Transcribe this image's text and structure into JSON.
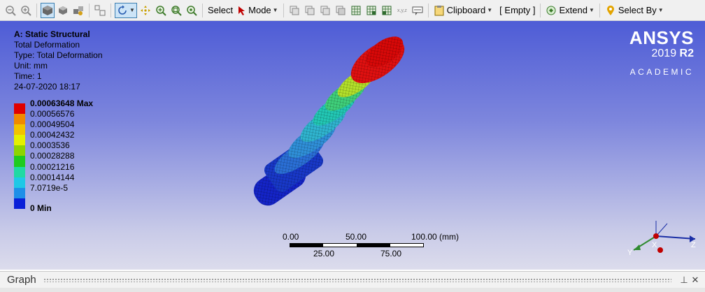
{
  "toolbar": {
    "select_label": "Select",
    "mode_label": "Mode",
    "clipboard_label": "Clipboard",
    "empty_label": "[ Empty ]",
    "extend_label": "Extend",
    "select_by_label": "Select By"
  },
  "result": {
    "title": "A: Static Structural",
    "name": "Total Deformation",
    "type": "Type: Total Deformation",
    "unit": "Unit: mm",
    "time": "Time: 1",
    "date": "24-07-2020 18:17"
  },
  "legend": {
    "items": [
      {
        "label": "0.00063648 Max",
        "color": "#e00000"
      },
      {
        "label": "0.00056576",
        "color": "#f08a00"
      },
      {
        "label": "0.00049504",
        "color": "#f2c300"
      },
      {
        "label": "0.00042432",
        "color": "#e4f000"
      },
      {
        "label": "0.0003536",
        "color": "#8ed400"
      },
      {
        "label": "0.00028288",
        "color": "#1fcb1f"
      },
      {
        "label": "0.00021216",
        "color": "#20d9a3"
      },
      {
        "label": "0.00014144",
        "color": "#1fc8e6"
      },
      {
        "label": "7.0719e-5",
        "color": "#1e8fe8"
      },
      {
        "label": "0 Min",
        "color": "#0a20d8"
      }
    ]
  },
  "logo": {
    "brand": "ANSYS",
    "version": "2019",
    "release": "R2",
    "edition": "ACADEMIC"
  },
  "scale": {
    "top_left": "0.00",
    "top_mid": "50.00",
    "top_right": "100.00 (mm)",
    "bottom_left": "25.00",
    "bottom_right": "75.00"
  },
  "triad": {
    "x": "X",
    "y": "Y",
    "z": "Z"
  },
  "graph": {
    "title": "Graph",
    "pin": "⊥",
    "close": "✕"
  }
}
